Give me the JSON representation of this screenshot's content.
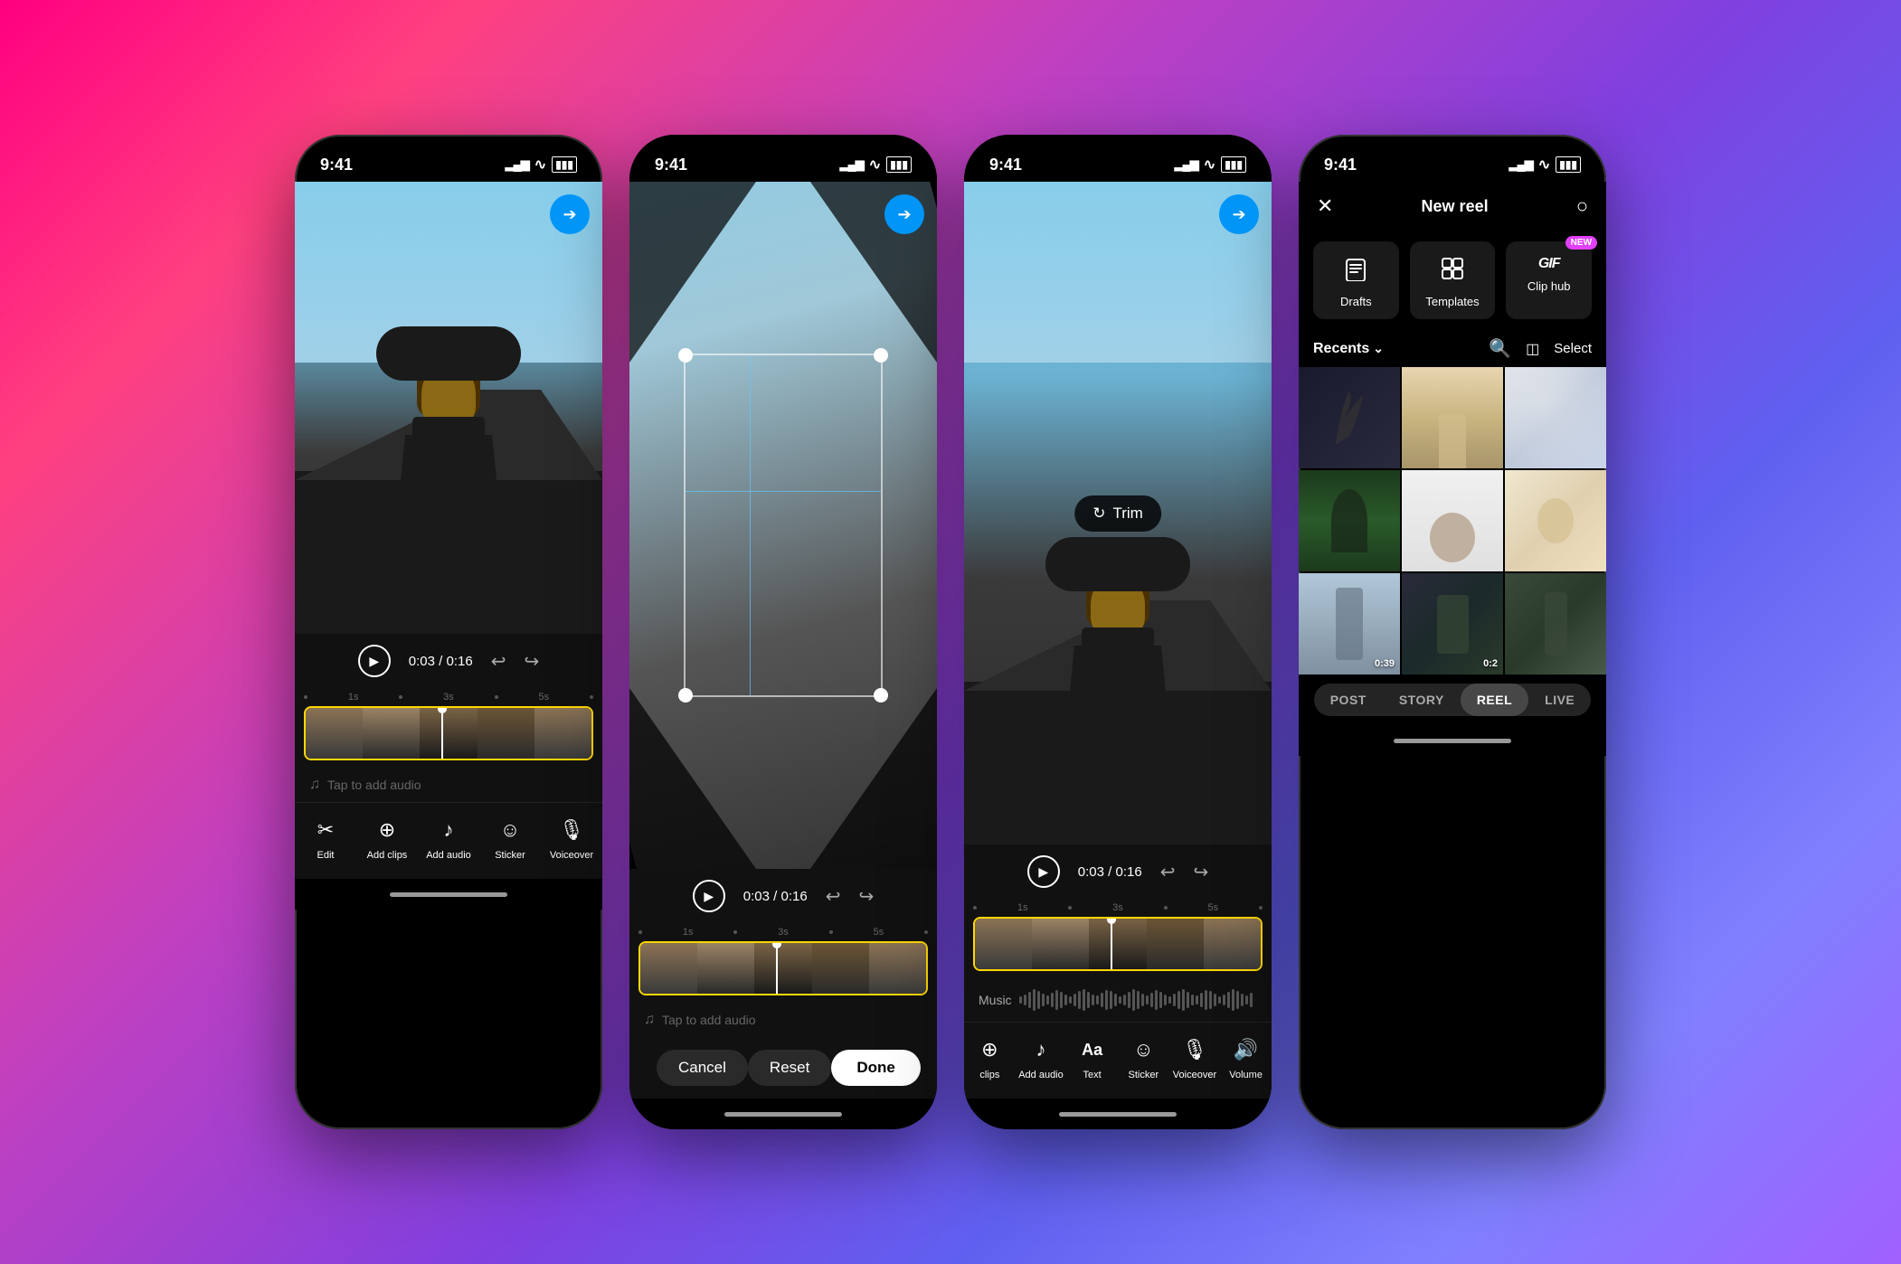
{
  "background": {
    "gradient": "linear-gradient(135deg, #ff0080, #ff4080, #c040c0, #8040e0, #6060f0, #a060ff)"
  },
  "phone1": {
    "statusBar": {
      "time": "9:41"
    },
    "timeDisplay": "0:03 / 0:16",
    "audioPlaceholder": "Tap to add audio",
    "tools": [
      {
        "id": "edit",
        "label": "Edit",
        "icon": "✂"
      },
      {
        "id": "add-clips",
        "label": "Add clips",
        "icon": "⊕"
      },
      {
        "id": "add-audio",
        "label": "Add audio",
        "icon": "♪"
      },
      {
        "id": "sticker",
        "label": "Sticker",
        "icon": "☺"
      },
      {
        "id": "voiceover",
        "label": "Voiceover",
        "icon": "🎙"
      }
    ],
    "timelineMarkers": [
      "1s",
      "3s",
      "5s"
    ]
  },
  "phone2": {
    "statusBar": {
      "time": "9:41"
    },
    "timeDisplay": "0:03 / 0:16",
    "audioPlaceholder": "Tap to add audio",
    "actions": {
      "cancel": "Cancel",
      "reset": "Reset",
      "done": "Done"
    },
    "timelineMarkers": [
      "1s",
      "3s",
      "5s"
    ]
  },
  "phone3": {
    "statusBar": {
      "time": "9:41"
    },
    "timeDisplay": "0:03 / 0:16",
    "trimLabel": "Trim",
    "musicLabel": "Music",
    "tools": [
      {
        "id": "add-clips",
        "label": "clips",
        "icon": "⊕"
      },
      {
        "id": "add-audio",
        "label": "Add audio",
        "icon": "♪"
      },
      {
        "id": "text",
        "label": "Text",
        "icon": "Aa"
      },
      {
        "id": "sticker",
        "label": "Sticker",
        "icon": "☺"
      },
      {
        "id": "voiceover",
        "label": "Voiceover",
        "icon": "🎙"
      },
      {
        "id": "volume",
        "label": "Volume",
        "icon": "🔊"
      }
    ],
    "timelineMarkers": [
      "1s",
      "3s",
      "5s"
    ]
  },
  "phone4": {
    "statusBar": {
      "time": "9:41"
    },
    "header": {
      "title": "New reel",
      "closeIcon": "✕",
      "settingsIcon": "○"
    },
    "quickActions": [
      {
        "id": "drafts",
        "label": "Drafts",
        "icon": "📋",
        "isNew": false
      },
      {
        "id": "templates",
        "label": "Templates",
        "icon": "⧉",
        "isNew": false
      },
      {
        "id": "clip-hub",
        "label": "Clip hub",
        "icon": "GIF",
        "isNew": true
      }
    ],
    "recents": {
      "label": "Recents",
      "hasDropdown": true,
      "searchIcon": "🔍",
      "selectLabel": "Select"
    },
    "gallery": [
      {
        "id": 1,
        "style": "gc-1",
        "duration": null
      },
      {
        "id": 2,
        "style": "gc-2",
        "duration": null
      },
      {
        "id": 3,
        "style": "gc-3",
        "duration": null
      },
      {
        "id": 4,
        "style": "gc-4",
        "duration": null
      },
      {
        "id": 5,
        "style": "gc-5",
        "duration": null
      },
      {
        "id": 6,
        "style": "gc-6",
        "duration": null
      },
      {
        "id": 7,
        "style": "gc-7",
        "duration": "0:39"
      },
      {
        "id": 8,
        "style": "gc-8",
        "duration": "0:2"
      },
      {
        "id": 9,
        "style": "gc-9",
        "duration": null
      }
    ],
    "postTypes": [
      {
        "id": "post",
        "label": "POST",
        "active": false
      },
      {
        "id": "story",
        "label": "STORY",
        "active": false
      },
      {
        "id": "reel",
        "label": "REEL",
        "active": true
      },
      {
        "id": "live",
        "label": "LIVE",
        "active": false
      }
    ]
  }
}
